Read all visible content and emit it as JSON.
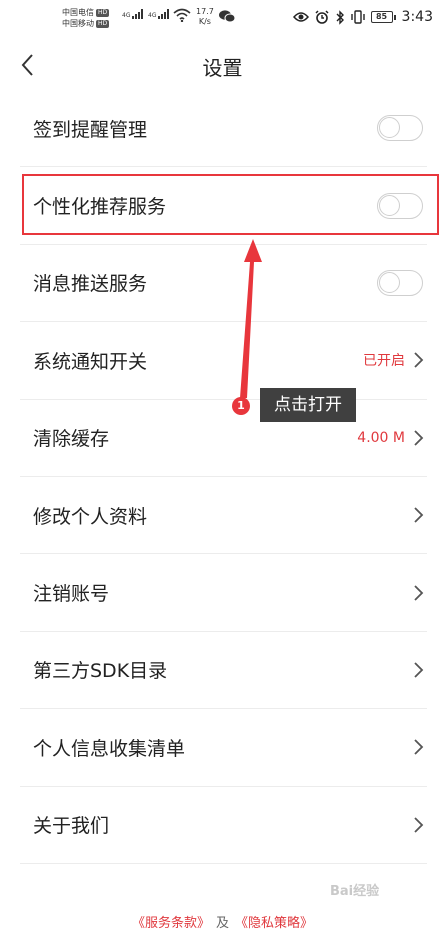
{
  "status_bar": {
    "carrier1": "中国电信",
    "carrier2": "中国移动",
    "hd": "HD",
    "net1": "4G",
    "net2": "4G",
    "speed_value": "17.7",
    "speed_unit": "K/s",
    "battery": "85",
    "time": "3:43"
  },
  "header": {
    "title": "设置"
  },
  "settings": [
    {
      "label": "签到提醒管理",
      "type": "toggle",
      "on": false
    },
    {
      "label": "个性化推荐服务",
      "type": "toggle",
      "on": false
    },
    {
      "label": "消息推送服务",
      "type": "toggle",
      "on": false
    },
    {
      "label": "系统通知开关",
      "type": "link",
      "value": "已开启"
    },
    {
      "label": "清除缓存",
      "type": "link",
      "value": "4.00 M"
    },
    {
      "label": "修改个人资料",
      "type": "link",
      "value": ""
    },
    {
      "label": "注销账号",
      "type": "link",
      "value": ""
    },
    {
      "label": "第三方SDK目录",
      "type": "link",
      "value": ""
    },
    {
      "label": "个人信息收集清单",
      "type": "link",
      "value": ""
    },
    {
      "label": "关于我们",
      "type": "link",
      "value": ""
    }
  ],
  "annotation": {
    "step": "1",
    "tip": "点击打开",
    "color": "#e8363c"
  },
  "footer": {
    "terms": "《服务条款》",
    "and": "及",
    "privacy": "《隐私策略》"
  },
  "watermark": "Bai经验",
  "colors": {
    "accent": "#e0393e",
    "toggle_off": "#cfcfcf"
  }
}
